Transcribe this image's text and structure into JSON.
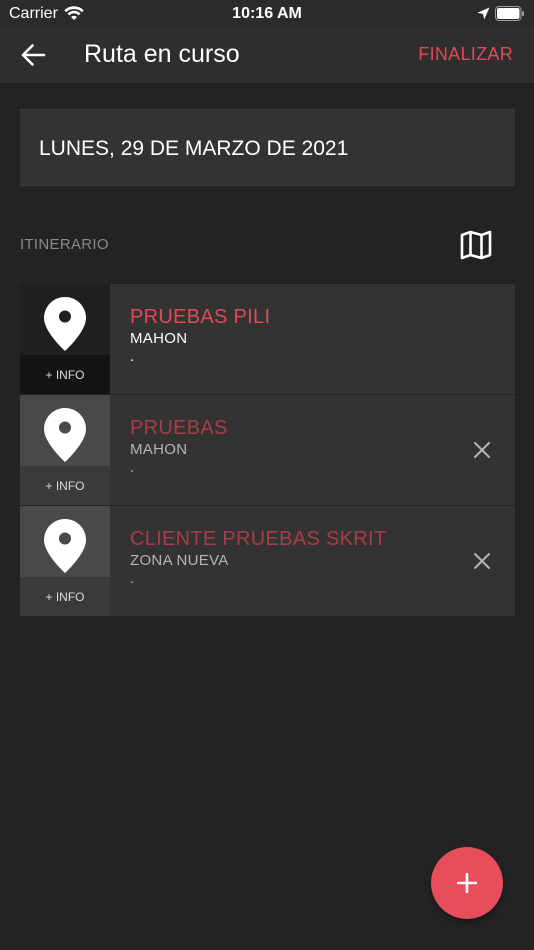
{
  "status_bar": {
    "carrier": "Carrier",
    "time": "10:16 AM",
    "icons": [
      "wifi-icon",
      "location-arrow-icon",
      "battery-icon"
    ]
  },
  "nav": {
    "back_icon": "arrow-left-icon",
    "title": "Ruta en curso",
    "action_label": "FINALIZAR"
  },
  "route": {
    "date": "LUNES, 29 DE MARZO DE 2021"
  },
  "itinerary": {
    "label": "ITINERARIO",
    "map_icon": "map-icon",
    "items": [
      {
        "name": "PRUEBAS PILI",
        "city": "MAHON",
        "detail": ".",
        "info_label": "+ INFO",
        "state": "active",
        "removable": false
      },
      {
        "name": "PRUEBAS",
        "city": "MAHON",
        "detail": ".",
        "info_label": "+ INFO",
        "state": "inactive",
        "removable": true
      },
      {
        "name": "CLIENTE PRUEBAS SKRIT",
        "city": "ZONA NUEVA",
        "detail": ".",
        "info_label": "+ INFO",
        "state": "inactive",
        "removable": true
      }
    ]
  },
  "fab": {
    "icon": "plus-icon"
  },
  "colors": {
    "background": "#232323",
    "accent": "#e04a55",
    "accent_muted": "#a83c48",
    "fab": "#e84d5a"
  }
}
